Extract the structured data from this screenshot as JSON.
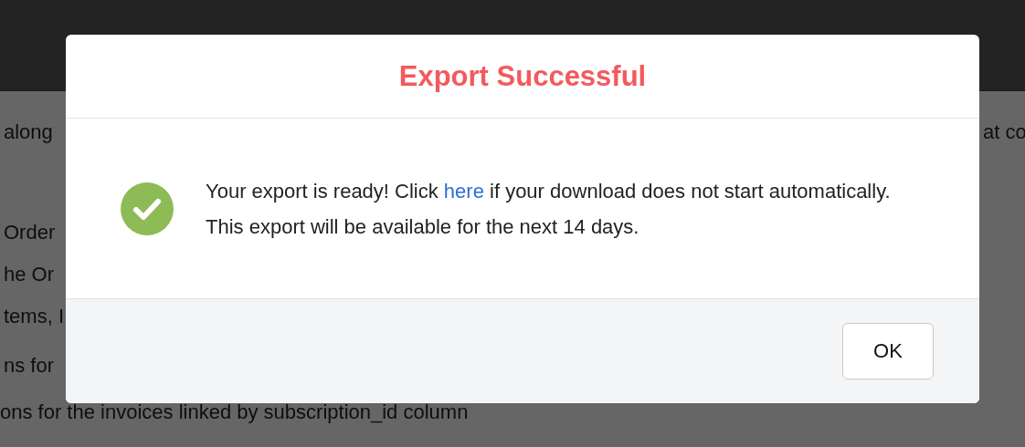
{
  "background_page": {
    "rows": [
      {
        "left": "along",
        "right": "at co"
      },
      {
        "left": "Order"
      },
      {
        "left": "he Or"
      },
      {
        "left": "tems, I"
      },
      {
        "left": "ns for"
      },
      {
        "left": "ons for the invoices linked by subscription_id column"
      }
    ]
  },
  "dialog": {
    "title": "Export Successful",
    "message": {
      "before": "Your export is ready! Click ",
      "link": "here",
      "after": " if your download does not start automatically. This export will be available for the next 14 days."
    },
    "buttons": [
      "OK"
    ]
  }
}
